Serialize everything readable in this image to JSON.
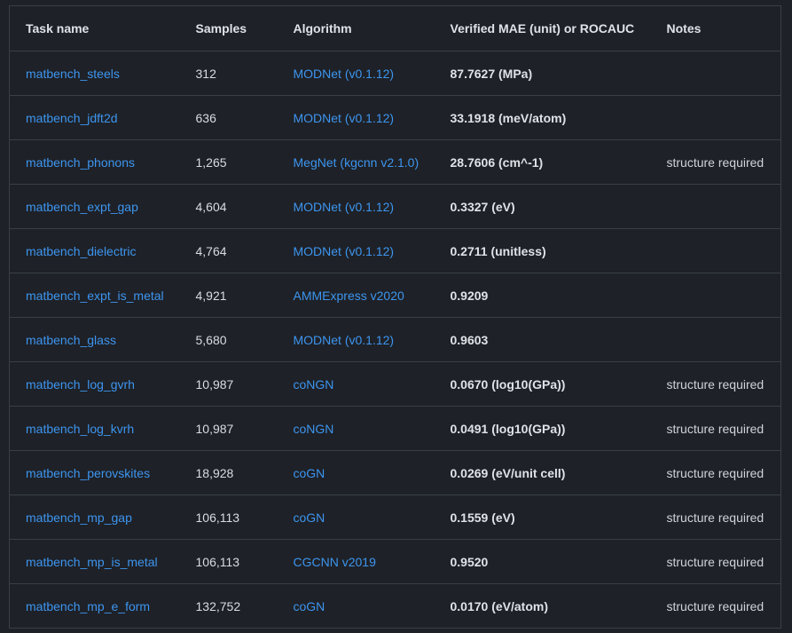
{
  "headers": {
    "task": "Task name",
    "samples": "Samples",
    "algorithm": "Algorithm",
    "mae": "Verified MAE (unit) or ROCAUC",
    "notes": "Notes"
  },
  "rows": [
    {
      "task": "matbench_steels",
      "samples": "312",
      "algorithm": "MODNet (v0.1.12)",
      "mae": "87.7627 (MPa)",
      "notes": ""
    },
    {
      "task": "matbench_jdft2d",
      "samples": "636",
      "algorithm": "MODNet (v0.1.12)",
      "mae": "33.1918 (meV/atom)",
      "notes": ""
    },
    {
      "task": "matbench_phonons",
      "samples": "1,265",
      "algorithm": "MegNet (kgcnn v2.1.0)",
      "mae": "28.7606 (cm^-1)",
      "notes": "structure required"
    },
    {
      "task": "matbench_expt_gap",
      "samples": "4,604",
      "algorithm": "MODNet (v0.1.12)",
      "mae": "0.3327 (eV)",
      "notes": ""
    },
    {
      "task": "matbench_dielectric",
      "samples": "4,764",
      "algorithm": "MODNet (v0.1.12)",
      "mae": "0.2711 (unitless)",
      "notes": ""
    },
    {
      "task": "matbench_expt_is_metal",
      "samples": "4,921",
      "algorithm": "AMMExpress v2020",
      "mae": "0.9209",
      "notes": ""
    },
    {
      "task": "matbench_glass",
      "samples": "5,680",
      "algorithm": "MODNet (v0.1.12)",
      "mae": "0.9603",
      "notes": ""
    },
    {
      "task": "matbench_log_gvrh",
      "samples": "10,987",
      "algorithm": "coNGN",
      "mae": "0.0670 (log10(GPa))",
      "notes": "structure required"
    },
    {
      "task": "matbench_log_kvrh",
      "samples": "10,987",
      "algorithm": "coNGN",
      "mae": "0.0491 (log10(GPa))",
      "notes": "structure required"
    },
    {
      "task": "matbench_perovskites",
      "samples": "18,928",
      "algorithm": "coGN",
      "mae": "0.0269 (eV/unit cell)",
      "notes": "structure required"
    },
    {
      "task": "matbench_mp_gap",
      "samples": "106,113",
      "algorithm": "coGN",
      "mae": "0.1559 (eV)",
      "notes": "structure required"
    },
    {
      "task": "matbench_mp_is_metal",
      "samples": "106,113",
      "algorithm": "CGCNN v2019",
      "mae": "0.9520",
      "notes": "structure required"
    },
    {
      "task": "matbench_mp_e_form",
      "samples": "132,752",
      "algorithm": "coGN",
      "mae": "0.0170 (eV/atom)",
      "notes": "structure required"
    }
  ],
  "colors": {
    "background": "#1e2127",
    "link": "#3d95ef",
    "text": "#d9dde2",
    "border": "#3a3f47"
  }
}
